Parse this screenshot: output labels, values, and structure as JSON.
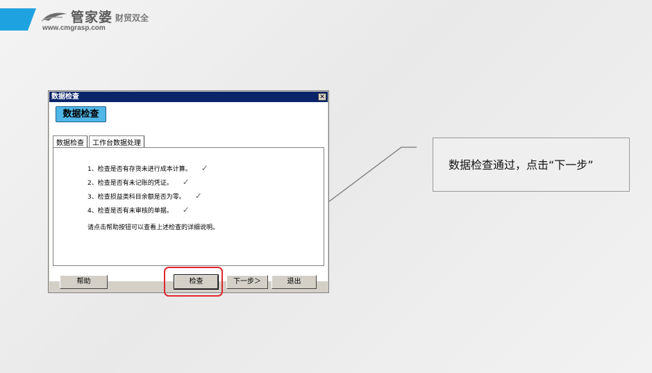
{
  "brand": {
    "name": "管家婆",
    "tagline": "财贸双全",
    "url": "www.cmgrasp.com",
    "accent_color": "#1fa3e0"
  },
  "dialog": {
    "title": "数据检查",
    "close_icon": "close-icon",
    "badge_text": "数据检查",
    "badge_color": "#4fb6e6",
    "tabs": [
      {
        "label": "数据检查",
        "active": true
      },
      {
        "label": "工作台数据处理",
        "active": false
      }
    ],
    "checks": [
      {
        "text": "1、检查是否有存货未进行成本计算。",
        "status": "✓"
      },
      {
        "text": "2、检查是否有未记账的凭证。",
        "status": "✓"
      },
      {
        "text": "3、检查损益类科目余额是否为零。",
        "status": "✓"
      },
      {
        "text": "4、检查是否有未审核的单据。",
        "status": "✓"
      }
    ],
    "help_note": "请点击帮助按钮可以查看上述检查的详细说明。",
    "buttons": {
      "help": "帮助",
      "check": "检查",
      "next": "下一步＞",
      "exit": "退出"
    }
  },
  "callout": {
    "text": "数据检查通过，点击“下一步”"
  },
  "highlight_color": "#e0262d"
}
